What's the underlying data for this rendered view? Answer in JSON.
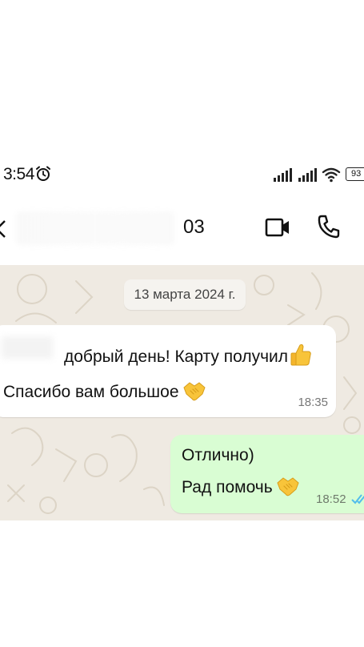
{
  "status_bar": {
    "time": "3:54",
    "battery": "93",
    "icons": [
      "alarm-icon",
      "signal-icon",
      "signal-icon",
      "wifi-icon",
      "battery-icon"
    ]
  },
  "header": {
    "contact_name": "03",
    "icons": [
      "back-arrow-icon",
      "video-call-icon",
      "voice-call-icon"
    ]
  },
  "chat": {
    "background_color": "#efeae2",
    "incoming_color": "#ffffff",
    "outgoing_color": "#d9fdd3",
    "tick_color": "#53bdeb",
    "date_separator": "13 марта 2024 г.",
    "messages": [
      {
        "direction": "incoming",
        "line1": "добрый день! Карту получил",
        "line1_emoji": "thumbs-up-icon",
        "line2": "Спасибо вам большое",
        "line2_emoji": "handshake-icon",
        "time": "18:35"
      },
      {
        "direction": "outgoing",
        "line1": "Отлично)",
        "line2": "Рад помочь",
        "line2_emoji": "handshake-icon",
        "time": "18:52",
        "status": "read-ticks-icon"
      }
    ]
  }
}
